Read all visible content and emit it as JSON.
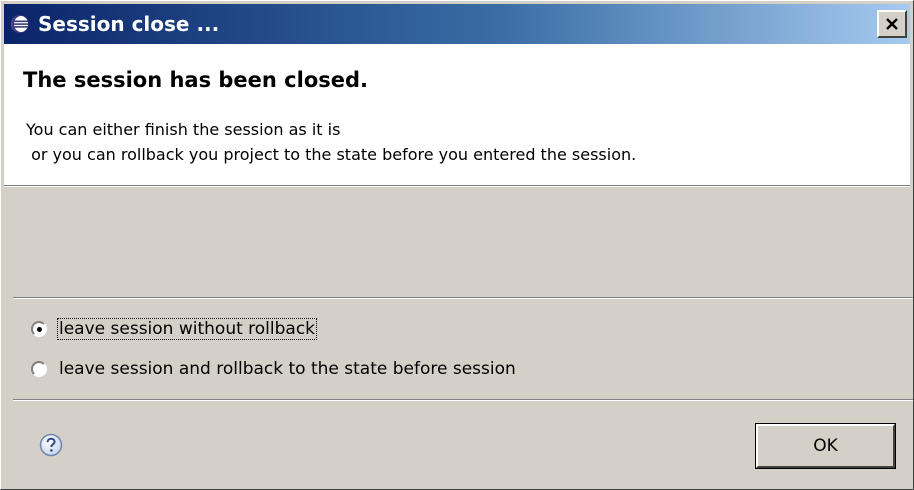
{
  "window": {
    "title": "Session close ...",
    "icon": "eclipse-icon",
    "close_icon": "close-icon"
  },
  "banner": {
    "title": "The session has been closed.",
    "message": "You can either finish the session as it is\n or you can rollback you project to the state before you entered the session."
  },
  "options": [
    {
      "label": "leave session without rollback",
      "selected": true,
      "focused": true
    },
    {
      "label": "leave session and rollback to the state before session",
      "selected": false,
      "focused": false
    }
  ],
  "footer": {
    "help_icon": "help-icon",
    "ok_label": "OK"
  },
  "colors": {
    "title_gradient_start": "#0a246a",
    "title_gradient_end": "#a6caf0",
    "dialog_bg": "#d4d0c8",
    "banner_bg": "#ffffff"
  }
}
